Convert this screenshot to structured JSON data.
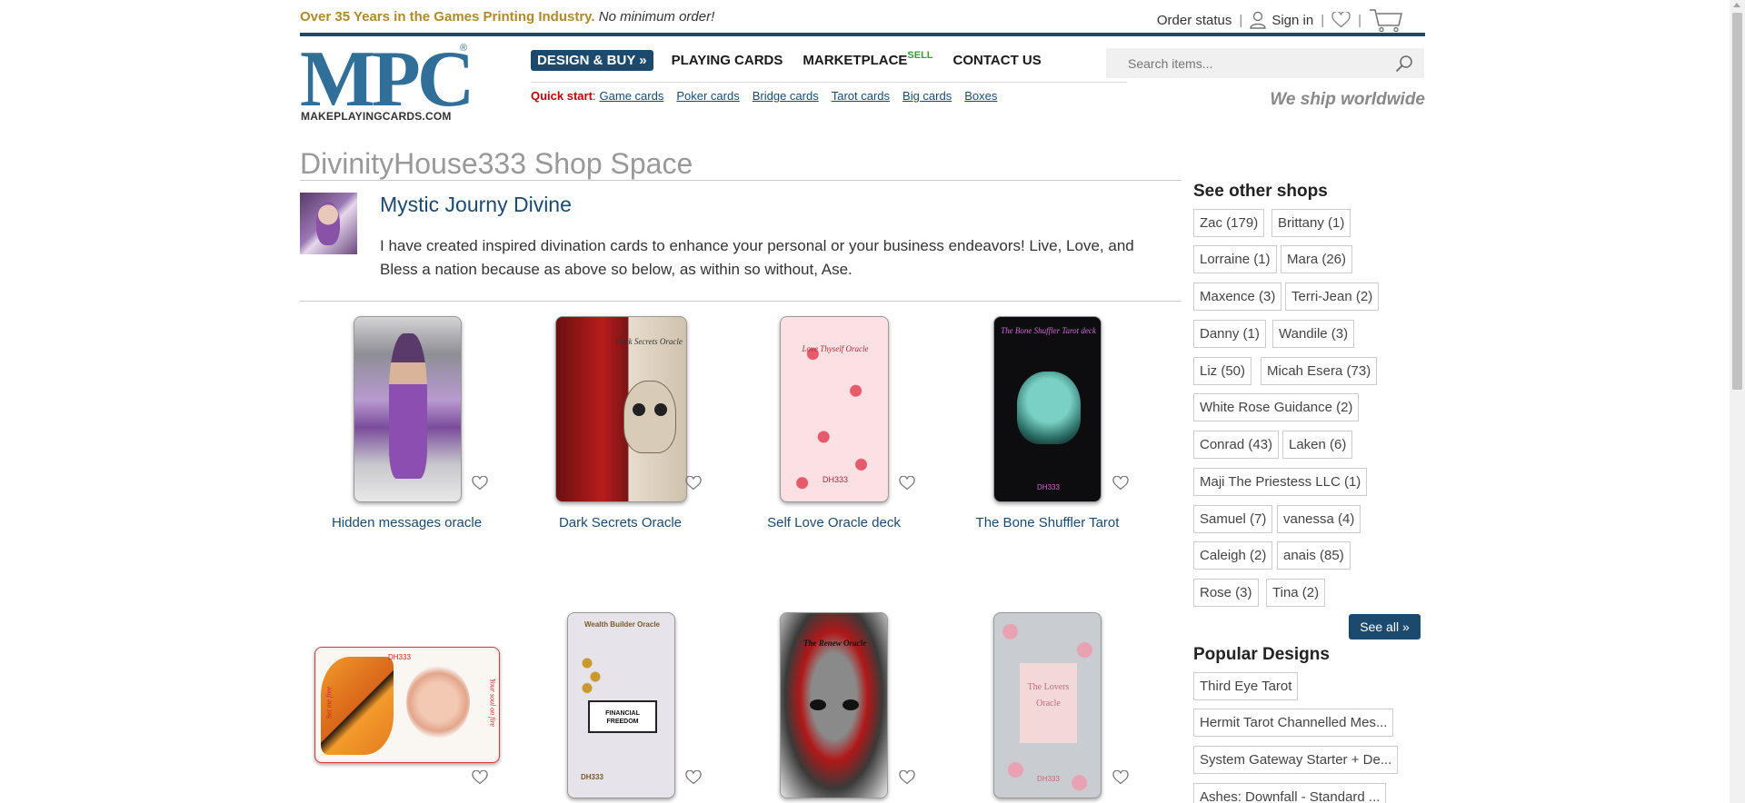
{
  "header": {
    "promo_bold": "Over 35 Years in the Games Printing Industry.",
    "promo_italic": "No minimum order!",
    "order_status": "Order status",
    "sign_in": "Sign in",
    "separator": "|"
  },
  "logo": {
    "mark": "MPC",
    "registered": "®",
    "site": "MAKEPLAYINGCARDS.COM"
  },
  "nav": {
    "design_buy": "DESIGN & BUY »",
    "playing_cards": "PLAYING CARDS",
    "marketplace": "MARKETPLACE",
    "sell": "SELL",
    "contact": "CONTACT US"
  },
  "quickstart": {
    "label": "Quick start",
    "colon": ":",
    "links": [
      "Game cards",
      "Poker cards",
      "Bridge cards",
      "Tarot cards",
      "Big cards",
      "Boxes"
    ]
  },
  "search": {
    "placeholder": "Search items..."
  },
  "ship_text": "We ship worldwide",
  "shop": {
    "title": "DivinityHouse333 Shop Space",
    "name": "Mystic Journy Divine",
    "description": "I have created inspired divination cards to enhance your personal or your business endeavors! Live, Love, and Bless a nation because as above so below, as within so without, Ase."
  },
  "products": [
    {
      "name": "Hidden messages oracle"
    },
    {
      "name": "Dark Secrets Oracle"
    },
    {
      "name": "Self Love Oracle deck"
    },
    {
      "name": "The Bone Shuffler Tarot"
    },
    {
      "name": ""
    },
    {
      "name": ""
    },
    {
      "name": ""
    },
    {
      "name": ""
    }
  ],
  "card_text": {
    "dark_secrets": "Dark Secrets Oracle",
    "self_love": "Love Thyself Oracle",
    "bone_shuffler": "The Bone Shuffler Tarot deck",
    "wealth": "Wealth Builder Oracle",
    "financial": "FINANCIAL FREEDOM",
    "dh": "DH333",
    "renew": "The Renew Oracle",
    "lovers": "The Lovers Oracle",
    "butterfly_left": "Set me free",
    "butterfly_right": "Your soul on fire"
  },
  "sidebar": {
    "other_shops_title": "See other shops",
    "shops": [
      "Zac (179)",
      "Brittany (1)",
      "Lorraine (1)",
      "Mara (26)",
      "Maxence (3)",
      "Terri-Jean (2)",
      "Danny (1)",
      "Wandile (3)",
      "Liz (50)",
      "Micah Esera (73)",
      "White Rose Guidance (2)",
      "Conrad (43)",
      "Laken (6)",
      "Maji The Priestess LLC (1)",
      "Samuel (7)",
      "vanessa (4)",
      "Caleigh (2)",
      "anais (85)",
      "Rose (3)",
      "Tina (2)"
    ],
    "see_all": "See all »",
    "popular_title": "Popular Designs",
    "popular": [
      "Third Eye Tarot",
      "Hermit Tarot Channelled Mes...",
      "System Gateway Starter + De...",
      "Ashes: Downfall - Standard ..."
    ]
  },
  "colors": {
    "brand_blue": "#1c4a6e",
    "promo_gold": "#b0892a",
    "quick_red": "#c00000",
    "sell_green": "#3a9b3a"
  }
}
